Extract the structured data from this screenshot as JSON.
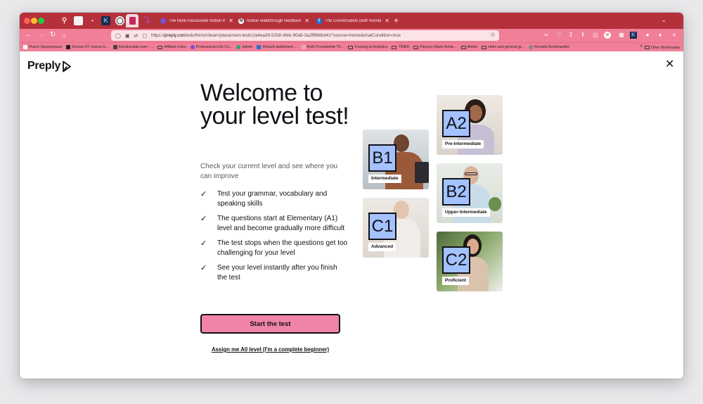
{
  "browser": {
    "tabs": [
      {
        "title": "The Multi-Passionate Notion Kit",
        "icon": "notion-kit-icon",
        "color": "#7b4fd6"
      },
      {
        "title": "Notion walkthrough feedback",
        "icon": "notion-icon",
        "color": "#ffffff"
      },
      {
        "title": "The Conversation (with Kerstin",
        "icon": "facebook-icon",
        "color": "#1877f2"
      }
    ],
    "url_domain": "preply.com",
    "url_prefix": "https://",
    "url_path": "/edu/french/learn/placement-test/c2a4ea29-5208-4feb-90a8-3a2ff866bd41?source=home&chatCondition=true",
    "bookmarks": [
      {
        "label": "Fluent Squarespace",
        "kind": "site",
        "color": "#ffffff"
      },
      {
        "label": "Denise DT course lo...",
        "kind": "site",
        "color": "#222222"
      },
      {
        "label": "Kerstincable.com - ...",
        "kind": "site",
        "color": "#444444"
      },
      {
        "label": "Affiliate Links",
        "kind": "folder"
      },
      {
        "label": "Professional Life Co...",
        "kind": "site",
        "color": "#7b4fd6"
      },
      {
        "label": "Admin",
        "kind": "site",
        "color": "#3aa06e"
      },
      {
        "label": "Default dashboard ...",
        "kind": "site",
        "color": "#2f6fd0"
      },
      {
        "label": "Ruth Poundwhite Th...",
        "kind": "site",
        "color": "#f1a6c4"
      },
      {
        "label": "Tracking & Analytics",
        "kind": "folder"
      },
      {
        "label": "TRIER",
        "kind": "folder"
      },
      {
        "label": "Fluency Made Achie...",
        "kind": "folder"
      },
      {
        "label": "Welsh",
        "kind": "folder"
      },
      {
        "label": "Hello and general gr...",
        "kind": "folder"
      },
      {
        "label": "Fireside Bookmarklet",
        "kind": "site",
        "color": "#888888"
      }
    ],
    "other_bookmarks": "Other Bookmarks"
  },
  "page": {
    "logo": "Preply",
    "headline": "Welcome to your level test!",
    "subtitle": "Check your current level and see where you can improve",
    "features": [
      "Test your grammar, vocabulary and speaking skills",
      "The questions start at Elementary (A1) level and become gradually more difficult",
      "The test stops when the questions get too challenging for your level",
      "See your level instantly after you finish the test"
    ],
    "start_button": "Start the test",
    "assign_link": "Assign me A0 level (I'm a complete beginner)",
    "levels": [
      {
        "code": "A2",
        "name": "Pre-Intermediate"
      },
      {
        "code": "B1",
        "name": "Intermediate"
      },
      {
        "code": "B2",
        "name": "Upper-Intermediate"
      },
      {
        "code": "C1",
        "name": "Advanced"
      },
      {
        "code": "C2",
        "name": "Proficient"
      }
    ],
    "accent_color": "#f083a6",
    "badge_color": "#a3c2ff"
  }
}
